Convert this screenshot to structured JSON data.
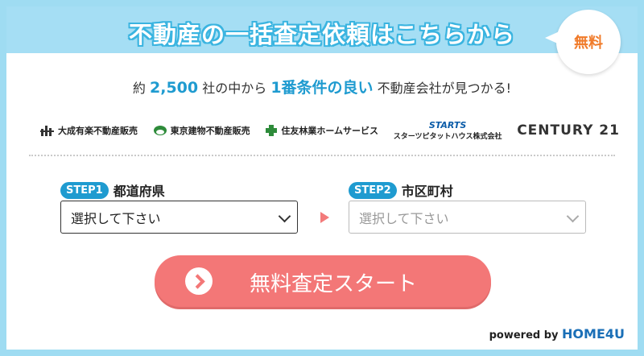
{
  "header": {
    "title": "不動産の一括査定依頼はこちらから",
    "badge": "無料"
  },
  "subtitle": {
    "pre": "約",
    "count": "2,500",
    "mid": "社の中から",
    "highlight": "1番条件の良い",
    "post": "不動産会社が見つかる!"
  },
  "logos": {
    "taisei": "大成有楽不動産販売",
    "tokyo": "東京建物不動産販売",
    "sumitomo": "住友林業ホームサービス",
    "starts_top": "STARTS",
    "starts_bottom": "スターツピタットハウス株式会社",
    "century": "CENTURY 21"
  },
  "step1": {
    "pill": "STEP1",
    "label": "都道府県",
    "value": "選択して下さい"
  },
  "step2": {
    "pill": "STEP2",
    "label": "市区町村",
    "value": "選択して下さい"
  },
  "cta": {
    "label": "無料査定スタート"
  },
  "footer": {
    "powered": "powered by",
    "brand": "HOME4U"
  },
  "colors": {
    "accent": "#1f9bd0",
    "cta": "#f37777",
    "header": "#a5def4"
  }
}
